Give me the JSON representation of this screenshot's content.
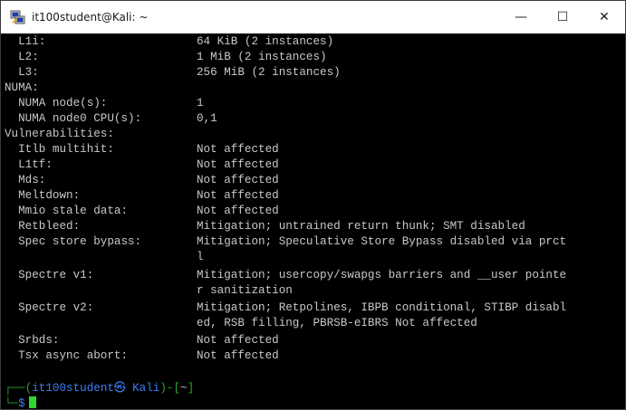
{
  "window": {
    "title": "it100student@Kali: ~",
    "icon": "putty-icon",
    "minimize_glyph": "—",
    "maximize_glyph": "☐",
    "close_glyph": "✕"
  },
  "terminal": {
    "rows": [
      {
        "label": "  L1i:",
        "value": "64 KiB (2 instances)"
      },
      {
        "label": "  L2:",
        "value": "1 MiB (2 instances)"
      },
      {
        "label": "  L3:",
        "value": "256 MiB (2 instances)"
      },
      {
        "label": "NUMA:",
        "value": ""
      },
      {
        "label": "  NUMA node(s):",
        "value": "1"
      },
      {
        "label": "  NUMA node0 CPU(s):",
        "value": "0,1"
      },
      {
        "label": "Vulnerabilities:",
        "value": ""
      },
      {
        "label": "  Itlb multihit:",
        "value": "Not affected"
      },
      {
        "label": "  L1tf:",
        "value": "Not affected"
      },
      {
        "label": "  Mds:",
        "value": "Not affected"
      },
      {
        "label": "  Meltdown:",
        "value": "Not affected"
      },
      {
        "label": "  Mmio stale data:",
        "value": "Not affected"
      },
      {
        "label": "  Retbleed:",
        "value": "Mitigation; untrained return thunk; SMT disabled"
      },
      {
        "label": "  Spec store bypass:",
        "value": "Mitigation; Speculative Store Bypass disabled via prct"
      },
      {
        "label": "",
        "value": "l"
      },
      {
        "label": "  Spectre v1:",
        "value": "Mitigation; usercopy/swapgs barriers and __user pointe"
      },
      {
        "label": "",
        "value": "r sanitization"
      },
      {
        "label": "  Spectre v2:",
        "value": "Mitigation; Retpolines, IBPB conditional, STIBP disabl"
      },
      {
        "label": "",
        "value": "ed, RSB filling, PBRSB-eIBRS Not affected"
      },
      {
        "label": "  Srbds:",
        "value": "Not affected"
      },
      {
        "label": "  Tsx async abort:",
        "value": "Not affected"
      },
      {
        "label": "",
        "value": ""
      }
    ],
    "prompt": {
      "frame_top": "┌──",
      "open_paren": "(",
      "user_host": "it100student㉿ Kali",
      "close_paren": ")",
      "dash": "-",
      "open_bracket": "[",
      "path": "~",
      "close_bracket": "]",
      "frame_bottom": "└─",
      "symbol": "$"
    },
    "colors": {
      "text": "#c8c8c8",
      "prompt_blue": "#3d7ef5",
      "frame_green": "#2aa52a",
      "cursor_green": "#2ed82e"
    }
  }
}
